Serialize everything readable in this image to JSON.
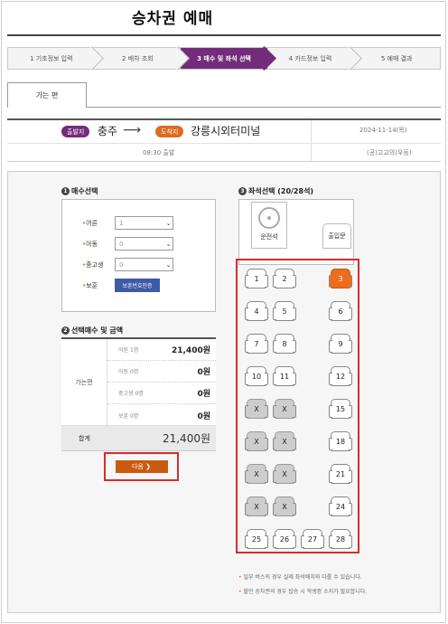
{
  "page_title": "승차권 예매",
  "steps": [
    "1 기초정보 입력",
    "2 배차 조회",
    "3 매수 및 좌석 선택",
    "4 카드정보 입력",
    "5 예매 결과"
  ],
  "tab_label": "가는 편",
  "route": {
    "dep_badge": "출발지",
    "dep_city": "충주",
    "arr_badge": "도착지",
    "arr_city": "강릉시외터미널",
    "date": "2024-11-14(목)",
    "time": "08:30 출발",
    "company": "(공)고교의(우등)"
  },
  "count_section": {
    "num": "1",
    "title": "매수선택",
    "rows": [
      {
        "label": "어른",
        "value": "1"
      },
      {
        "label": "아동",
        "value": "0"
      },
      {
        "label": "중고생",
        "value": "0"
      }
    ],
    "veteran_label": "보훈",
    "veteran_button": "보훈번호인증"
  },
  "price_section": {
    "num": "2",
    "title": "선택매수 및 금액",
    "category": "가는편",
    "lines": [
      {
        "label": "어른 1명",
        "value": "21,400원"
      },
      {
        "label": "아동 0명",
        "value": "0원"
      },
      {
        "label": "중고생 0명",
        "value": "0원"
      },
      {
        "label": "보훈 0명",
        "value": "0원"
      }
    ],
    "total_label": "합계",
    "total_value": "21,400원"
  },
  "next_button": "다음 ❯",
  "seat_section": {
    "num": "3",
    "title": "좌석선택 (20/28석)",
    "driver_label": "운전석",
    "door_label": "출입문",
    "selected_seat": "3",
    "seats": [
      {
        "label": "1",
        "state": "available"
      },
      {
        "label": "2",
        "state": "available"
      },
      {
        "label": "3",
        "state": "selected"
      },
      {
        "label": "4",
        "state": "available"
      },
      {
        "label": "5",
        "state": "available"
      },
      {
        "label": "6",
        "state": "available"
      },
      {
        "label": "7",
        "state": "available"
      },
      {
        "label": "8",
        "state": "available"
      },
      {
        "label": "9",
        "state": "available"
      },
      {
        "label": "10",
        "state": "available"
      },
      {
        "label": "11",
        "state": "available"
      },
      {
        "label": "12",
        "state": "available"
      },
      {
        "label": "X",
        "state": "taken"
      },
      {
        "label": "X",
        "state": "taken"
      },
      {
        "label": "15",
        "state": "available"
      },
      {
        "label": "X",
        "state": "taken"
      },
      {
        "label": "X",
        "state": "taken"
      },
      {
        "label": "18",
        "state": "available"
      },
      {
        "label": "X",
        "state": "taken"
      },
      {
        "label": "X",
        "state": "taken"
      },
      {
        "label": "21",
        "state": "available"
      },
      {
        "label": "X",
        "state": "taken"
      },
      {
        "label": "X",
        "state": "taken"
      },
      {
        "label": "24",
        "state": "available"
      },
      {
        "label": "25",
        "state": "available"
      },
      {
        "label": "26",
        "state": "available"
      },
      {
        "label": "27",
        "state": "available"
      },
      {
        "label": "28",
        "state": "available"
      }
    ]
  },
  "notes": [
    "일부 버스의 경우 실제 좌석배치와 다를 수 있습니다.",
    "할인 승차권의 경우 탑승 시 학생증 소지가 필요합니다."
  ],
  "colors": {
    "accent_purple": "#732c7a",
    "accent_orange": "#ee6d1d",
    "highlight_red": "#d92b2b",
    "button_blue": "#3f5aa6"
  }
}
